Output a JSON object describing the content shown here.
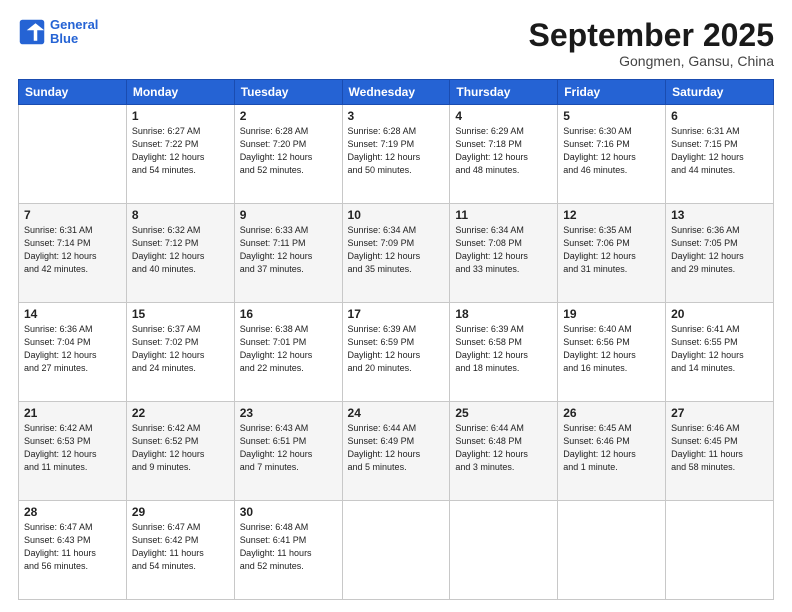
{
  "header": {
    "logo_line1": "General",
    "logo_line2": "Blue",
    "month": "September 2025",
    "location": "Gongmen, Gansu, China"
  },
  "days_of_week": [
    "Sunday",
    "Monday",
    "Tuesday",
    "Wednesday",
    "Thursday",
    "Friday",
    "Saturday"
  ],
  "weeks": [
    [
      {
        "day": "",
        "info": ""
      },
      {
        "day": "1",
        "info": "Sunrise: 6:27 AM\nSunset: 7:22 PM\nDaylight: 12 hours\nand 54 minutes."
      },
      {
        "day": "2",
        "info": "Sunrise: 6:28 AM\nSunset: 7:20 PM\nDaylight: 12 hours\nand 52 minutes."
      },
      {
        "day": "3",
        "info": "Sunrise: 6:28 AM\nSunset: 7:19 PM\nDaylight: 12 hours\nand 50 minutes."
      },
      {
        "day": "4",
        "info": "Sunrise: 6:29 AM\nSunset: 7:18 PM\nDaylight: 12 hours\nand 48 minutes."
      },
      {
        "day": "5",
        "info": "Sunrise: 6:30 AM\nSunset: 7:16 PM\nDaylight: 12 hours\nand 46 minutes."
      },
      {
        "day": "6",
        "info": "Sunrise: 6:31 AM\nSunset: 7:15 PM\nDaylight: 12 hours\nand 44 minutes."
      }
    ],
    [
      {
        "day": "7",
        "info": "Sunrise: 6:31 AM\nSunset: 7:14 PM\nDaylight: 12 hours\nand 42 minutes."
      },
      {
        "day": "8",
        "info": "Sunrise: 6:32 AM\nSunset: 7:12 PM\nDaylight: 12 hours\nand 40 minutes."
      },
      {
        "day": "9",
        "info": "Sunrise: 6:33 AM\nSunset: 7:11 PM\nDaylight: 12 hours\nand 37 minutes."
      },
      {
        "day": "10",
        "info": "Sunrise: 6:34 AM\nSunset: 7:09 PM\nDaylight: 12 hours\nand 35 minutes."
      },
      {
        "day": "11",
        "info": "Sunrise: 6:34 AM\nSunset: 7:08 PM\nDaylight: 12 hours\nand 33 minutes."
      },
      {
        "day": "12",
        "info": "Sunrise: 6:35 AM\nSunset: 7:06 PM\nDaylight: 12 hours\nand 31 minutes."
      },
      {
        "day": "13",
        "info": "Sunrise: 6:36 AM\nSunset: 7:05 PM\nDaylight: 12 hours\nand 29 minutes."
      }
    ],
    [
      {
        "day": "14",
        "info": "Sunrise: 6:36 AM\nSunset: 7:04 PM\nDaylight: 12 hours\nand 27 minutes."
      },
      {
        "day": "15",
        "info": "Sunrise: 6:37 AM\nSunset: 7:02 PM\nDaylight: 12 hours\nand 24 minutes."
      },
      {
        "day": "16",
        "info": "Sunrise: 6:38 AM\nSunset: 7:01 PM\nDaylight: 12 hours\nand 22 minutes."
      },
      {
        "day": "17",
        "info": "Sunrise: 6:39 AM\nSunset: 6:59 PM\nDaylight: 12 hours\nand 20 minutes."
      },
      {
        "day": "18",
        "info": "Sunrise: 6:39 AM\nSunset: 6:58 PM\nDaylight: 12 hours\nand 18 minutes."
      },
      {
        "day": "19",
        "info": "Sunrise: 6:40 AM\nSunset: 6:56 PM\nDaylight: 12 hours\nand 16 minutes."
      },
      {
        "day": "20",
        "info": "Sunrise: 6:41 AM\nSunset: 6:55 PM\nDaylight: 12 hours\nand 14 minutes."
      }
    ],
    [
      {
        "day": "21",
        "info": "Sunrise: 6:42 AM\nSunset: 6:53 PM\nDaylight: 12 hours\nand 11 minutes."
      },
      {
        "day": "22",
        "info": "Sunrise: 6:42 AM\nSunset: 6:52 PM\nDaylight: 12 hours\nand 9 minutes."
      },
      {
        "day": "23",
        "info": "Sunrise: 6:43 AM\nSunset: 6:51 PM\nDaylight: 12 hours\nand 7 minutes."
      },
      {
        "day": "24",
        "info": "Sunrise: 6:44 AM\nSunset: 6:49 PM\nDaylight: 12 hours\nand 5 minutes."
      },
      {
        "day": "25",
        "info": "Sunrise: 6:44 AM\nSunset: 6:48 PM\nDaylight: 12 hours\nand 3 minutes."
      },
      {
        "day": "26",
        "info": "Sunrise: 6:45 AM\nSunset: 6:46 PM\nDaylight: 12 hours\nand 1 minute."
      },
      {
        "day": "27",
        "info": "Sunrise: 6:46 AM\nSunset: 6:45 PM\nDaylight: 11 hours\nand 58 minutes."
      }
    ],
    [
      {
        "day": "28",
        "info": "Sunrise: 6:47 AM\nSunset: 6:43 PM\nDaylight: 11 hours\nand 56 minutes."
      },
      {
        "day": "29",
        "info": "Sunrise: 6:47 AM\nSunset: 6:42 PM\nDaylight: 11 hours\nand 54 minutes."
      },
      {
        "day": "30",
        "info": "Sunrise: 6:48 AM\nSunset: 6:41 PM\nDaylight: 11 hours\nand 52 minutes."
      },
      {
        "day": "",
        "info": ""
      },
      {
        "day": "",
        "info": ""
      },
      {
        "day": "",
        "info": ""
      },
      {
        "day": "",
        "info": ""
      }
    ]
  ]
}
